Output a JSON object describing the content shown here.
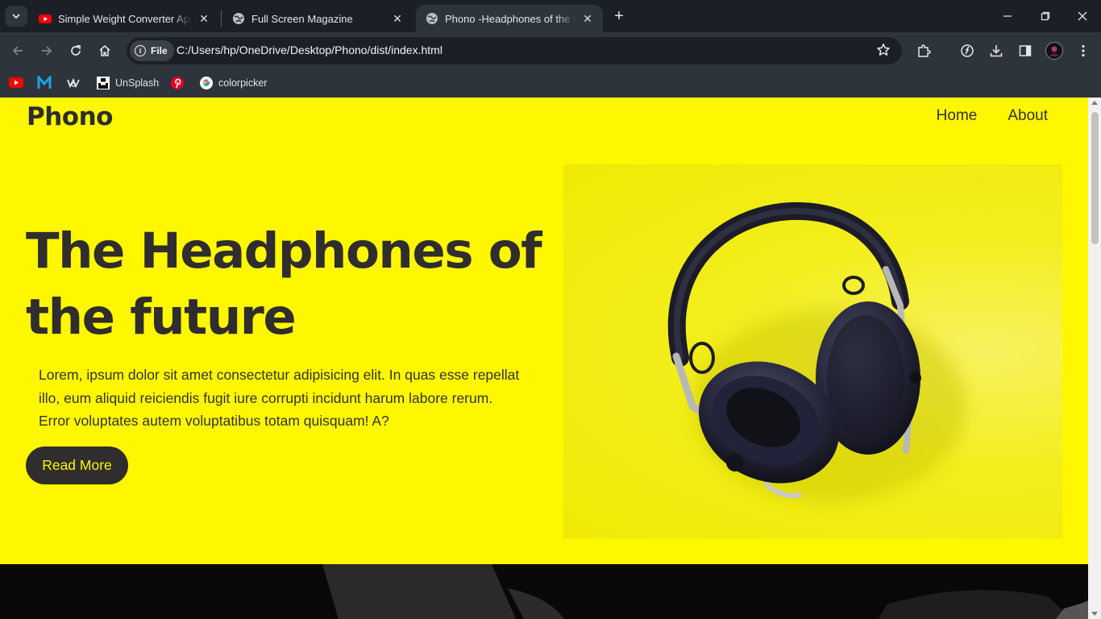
{
  "browser": {
    "tabs": [
      {
        "title": "Simple Weight Converter App W",
        "favicon": "youtube-icon",
        "active": false
      },
      {
        "title": "Full Screen Magazine",
        "favicon": "globe-icon",
        "active": false
      },
      {
        "title": "Phono -Headphones of the future",
        "favicon": "globe-icon",
        "active": true
      }
    ],
    "address": {
      "scheme_chip": "File",
      "url": "C:/Users/hp/OneDrive/Desktop/Phono/dist/index.html"
    },
    "bookmarks": [
      {
        "label": "",
        "icon": "youtube-icon"
      },
      {
        "label": "",
        "icon": "m-logo-icon"
      },
      {
        "label": "",
        "icon": "webflow-icon"
      },
      {
        "label": "UnSplash",
        "icon": "unsplash-icon"
      },
      {
        "label": "",
        "icon": "pinterest-icon"
      },
      {
        "label": "colorpicker",
        "icon": "google-icon"
      }
    ],
    "colors": {
      "chrome_bg": "#1c2026",
      "toolbar_bg": "#2e343c"
    }
  },
  "page": {
    "logo": "Phono",
    "nav": [
      {
        "label": "Home"
      },
      {
        "label": "About"
      }
    ],
    "hero": {
      "title": "The Headphones of the future",
      "text": "Lorem, ipsum dolor sit amet consectetur adipisicing elit. In quas esse repellat illo, eum aliquid reiciendis fugit iure corrupti incidunt harum labore rerum. Error voluptates autem voluptatibus totam quisquam! A?",
      "button": "Read More"
    },
    "colors": {
      "brand_yellow": "#fff700",
      "dark_text": "#2f2d2d"
    }
  }
}
